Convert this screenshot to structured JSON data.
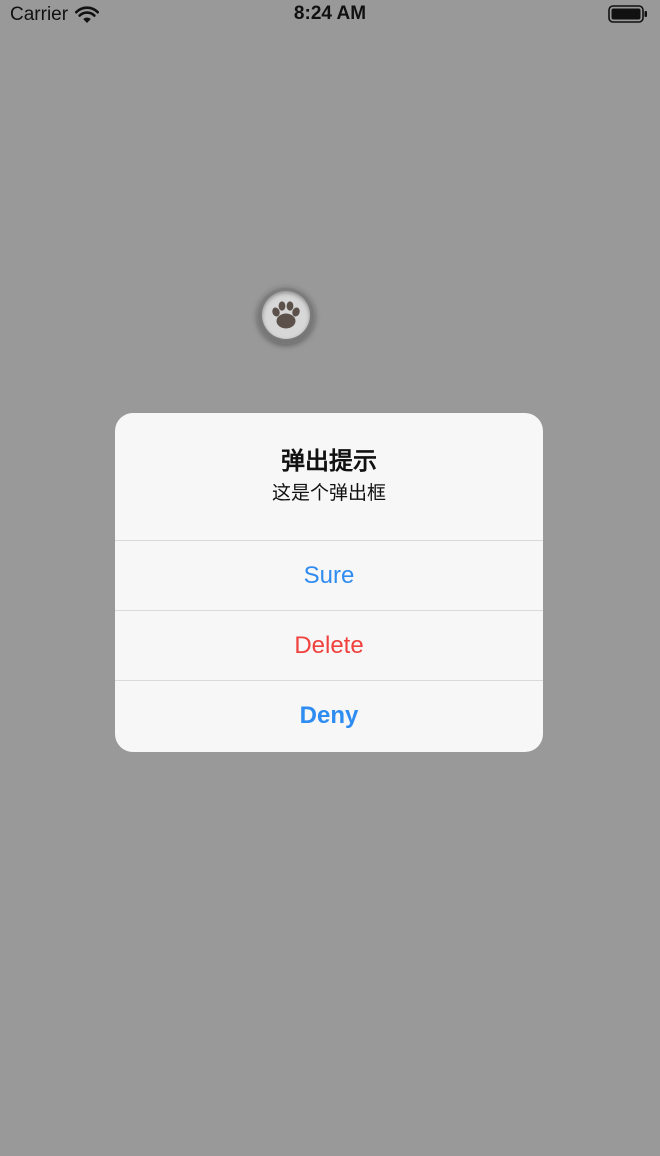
{
  "status_bar": {
    "carrier": "Carrier",
    "time": "8:24 AM",
    "icons": [
      "wifi-icon",
      "battery-icon"
    ]
  },
  "paw_button": {
    "icon": "paw-icon"
  },
  "alert": {
    "title": "弹出提示",
    "message": "这是个弹出框",
    "actions": [
      {
        "label": "Sure",
        "style": "default",
        "color": "#2f8cf0"
      },
      {
        "label": "Delete",
        "style": "destructive",
        "color": "#f0413f"
      },
      {
        "label": "Deny",
        "style": "cancel",
        "color": "#2f8cf0"
      }
    ]
  },
  "colors": {
    "dim_background": "#999999",
    "alert_background": "#f7f7f7",
    "separator": "#dadada"
  }
}
